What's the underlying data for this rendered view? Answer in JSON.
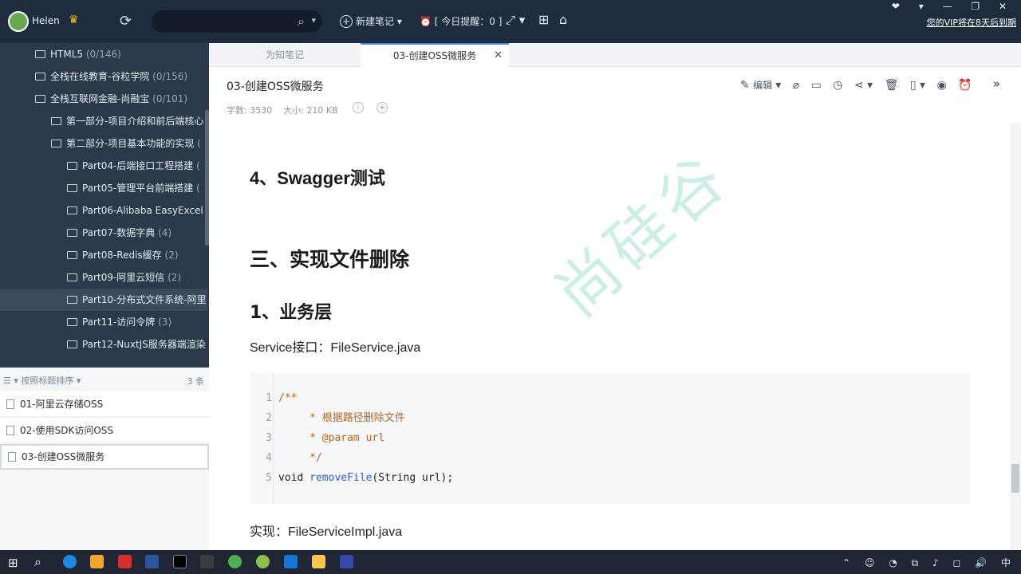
{
  "topbar": {
    "username": "Helen",
    "new_note_label": "新建笔记",
    "reminder_label": "[ 今日提醒：0 ]",
    "vip_notice": "您的VIP将在8天后到期",
    "window_controls": "❤ ▾ — ❐ ✕"
  },
  "sidebar": {
    "tree": [
      {
        "label": "HTML5",
        "count": "(0/146)"
      },
      {
        "label": "全栈在线教育-谷粒学院",
        "count": "(0/156)"
      },
      {
        "label": "全栈互联网金融-尚融宝",
        "count": "(0/101)"
      },
      {
        "label": "第一部分-项目介绍和前后端核心",
        "count": ""
      },
      {
        "label": "第二部分-项目基本功能的实现",
        "count": "("
      },
      {
        "label": "Part04-后端接口工程搭建",
        "count": "("
      },
      {
        "label": "Part05-管理平台前端搭建",
        "count": "("
      },
      {
        "label": "Part06-Alibaba EasyExcel",
        "count": "("
      },
      {
        "label": "Part07-数据字典",
        "count": "(4)"
      },
      {
        "label": "Part08-Redis缓存",
        "count": "(2)"
      },
      {
        "label": "Part09-阿里云短信",
        "count": "(2)"
      },
      {
        "label": "Part10-分布式文件系统-阿里",
        "count": ""
      },
      {
        "label": "Part11-访问令牌",
        "count": "(3)"
      },
      {
        "label": "Part12-NuxtJS服务器端渲染",
        "count": ""
      }
    ],
    "notelist": {
      "sort_label": "按照标题排序",
      "count": "3 条",
      "items": [
        "01-阿里云存储OSS",
        "02-使用SDK访问OSS",
        "03-创建OSS微服务"
      ]
    }
  },
  "tabs": [
    "为知笔记",
    "03-创建OSS微服务"
  ],
  "note": {
    "title": "03-创建OSS微服务",
    "word_count": "字数: 3530",
    "size": "大小: 210 KB",
    "edit_label": "编辑"
  },
  "content": {
    "heading_swagger": "4、Swagger测试",
    "heading_section": "三、实现文件删除",
    "heading_biz": "1、业务层",
    "service_line": "Service接口：FileService.java",
    "impl_line": "实现：FileServiceImpl.java",
    "watermark": "尚硅谷",
    "code": [
      {
        "n": "1",
        "text": "/**"
      },
      {
        "n": "2",
        "text": "     * 根据路径删除文件"
      },
      {
        "n": "3",
        "text": "     * @param url"
      },
      {
        "n": "4",
        "text": "     */"
      },
      {
        "n": "5",
        "pre": "void ",
        "fn": "removeFile",
        "post": "(String url);"
      }
    ]
  },
  "taskbar": {
    "tray": "⌃ ☺ ◔ ⧉ ♪ ◻ 🔊 中"
  },
  "icons": {
    "search": "search-icon",
    "sync": "sync-icon",
    "crown": "crown-icon"
  }
}
